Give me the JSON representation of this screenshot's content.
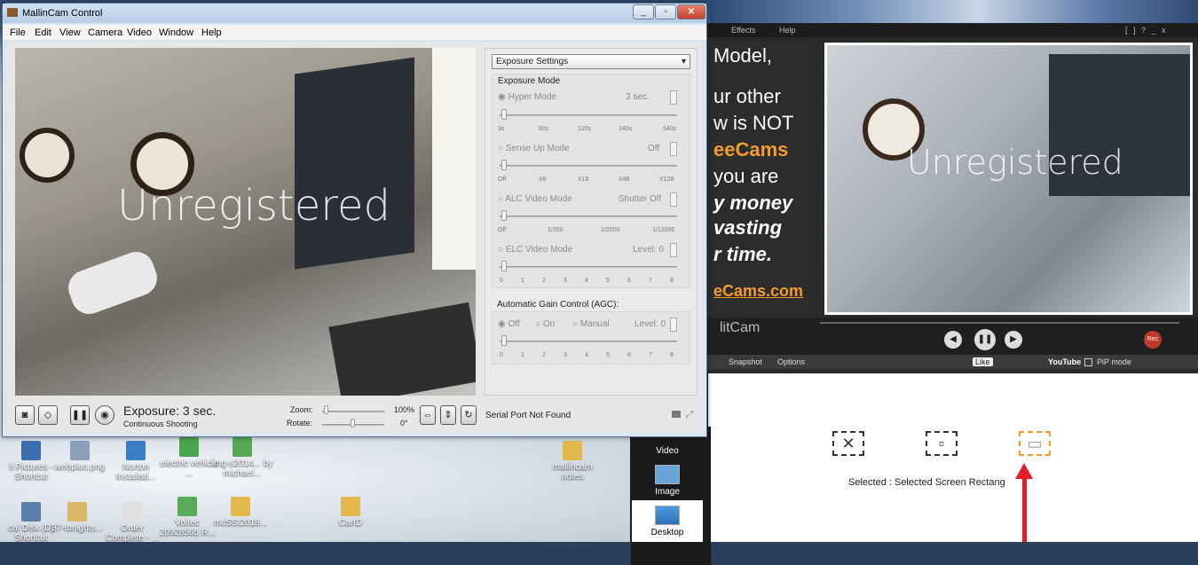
{
  "desktop": {
    "icons": [
      {
        "label": "ll Pictures -\nShortcut"
      },
      {
        "label": "webplus.png"
      },
      {
        "label": "Norton\nInstallati..."
      },
      {
        "label": "electric\nvehicle ..."
      },
      {
        "label": "img-s2014...\nby michael..."
      },
      {
        "label": "mallincam\nnotes"
      },
      {
        "label": "cal Disk (D)\nShortcut"
      },
      {
        "label": "37-tonights..."
      },
      {
        "label": "Order\nComplete - ..."
      },
      {
        "label": "Voltec\n20928565 R..."
      },
      {
        "label": "mcSSI2018..."
      },
      {
        "label": "CarID"
      }
    ]
  },
  "splitcam": {
    "menu": {
      "effects": "Effects",
      "help": "Help",
      "win": "[ ]  ?  _  x"
    },
    "ad": [
      "Model,",
      "ur other",
      "w is NOT",
      "eeCams",
      "you are",
      "y money",
      "vasting",
      "r time.",
      "eCams.com"
    ],
    "watermark": "Unregistered",
    "brand": "litCam",
    "rec": "Rec",
    "tabs": {
      "snapshot": "Snapshot",
      "options": "Options",
      "like": "Like",
      "youtube": "YouTube",
      "pip": "PiP mode"
    },
    "sidebar": [
      {
        "label": "Video"
      },
      {
        "label": "Image"
      },
      {
        "label": "Desktop"
      }
    ],
    "selected_text": "Selected : Selected Screen Rectang"
  },
  "mallincam": {
    "title": "MallinCam Control",
    "menu": [
      "File",
      "Edit",
      "View",
      "Camera",
      "Video",
      "Window",
      "Help"
    ],
    "watermark": "Unregistered",
    "panel": {
      "dropdown": "Exposure Settings",
      "exposure_group": "Exposure Mode",
      "hyper": {
        "label": "Hyper Mode",
        "value": "3 sec.",
        "ticks": [
          "3s",
          "60s",
          "120s",
          "240s",
          "540s"
        ]
      },
      "senseup": {
        "label": "Sense Up Mode",
        "value": "Off",
        "ticks": [
          "Off",
          "X6",
          "X16",
          "X48",
          "X128"
        ]
      },
      "alc": {
        "label": "ALC Video Mode",
        "value": "Shutter Off",
        "ticks": [
          "Off",
          "1/350",
          "1/2000",
          "1/12000"
        ]
      },
      "elc": {
        "label": "ELC Video Mode",
        "value": "Level: 0",
        "ticks": [
          "0",
          "1",
          "2",
          "3",
          "4",
          "5",
          "6",
          "7",
          "8"
        ]
      },
      "agc_group": "Automatic Gain Control (AGC):",
      "agc": {
        "off": "Off",
        "on": "On",
        "manual": "Manual",
        "value": "Level: 0",
        "ticks": [
          "0",
          "1",
          "2",
          "3",
          "4",
          "5",
          "6",
          "7",
          "8"
        ]
      }
    },
    "status": {
      "exposure": "Exposure: 3 sec.",
      "mode": "Continuous Shooting",
      "zoom_label": "Zoom:",
      "zoom_value": "100%",
      "rotate_label": "Rotate:",
      "rotate_value": "0°",
      "serial": "Serial Port Not Found"
    }
  }
}
